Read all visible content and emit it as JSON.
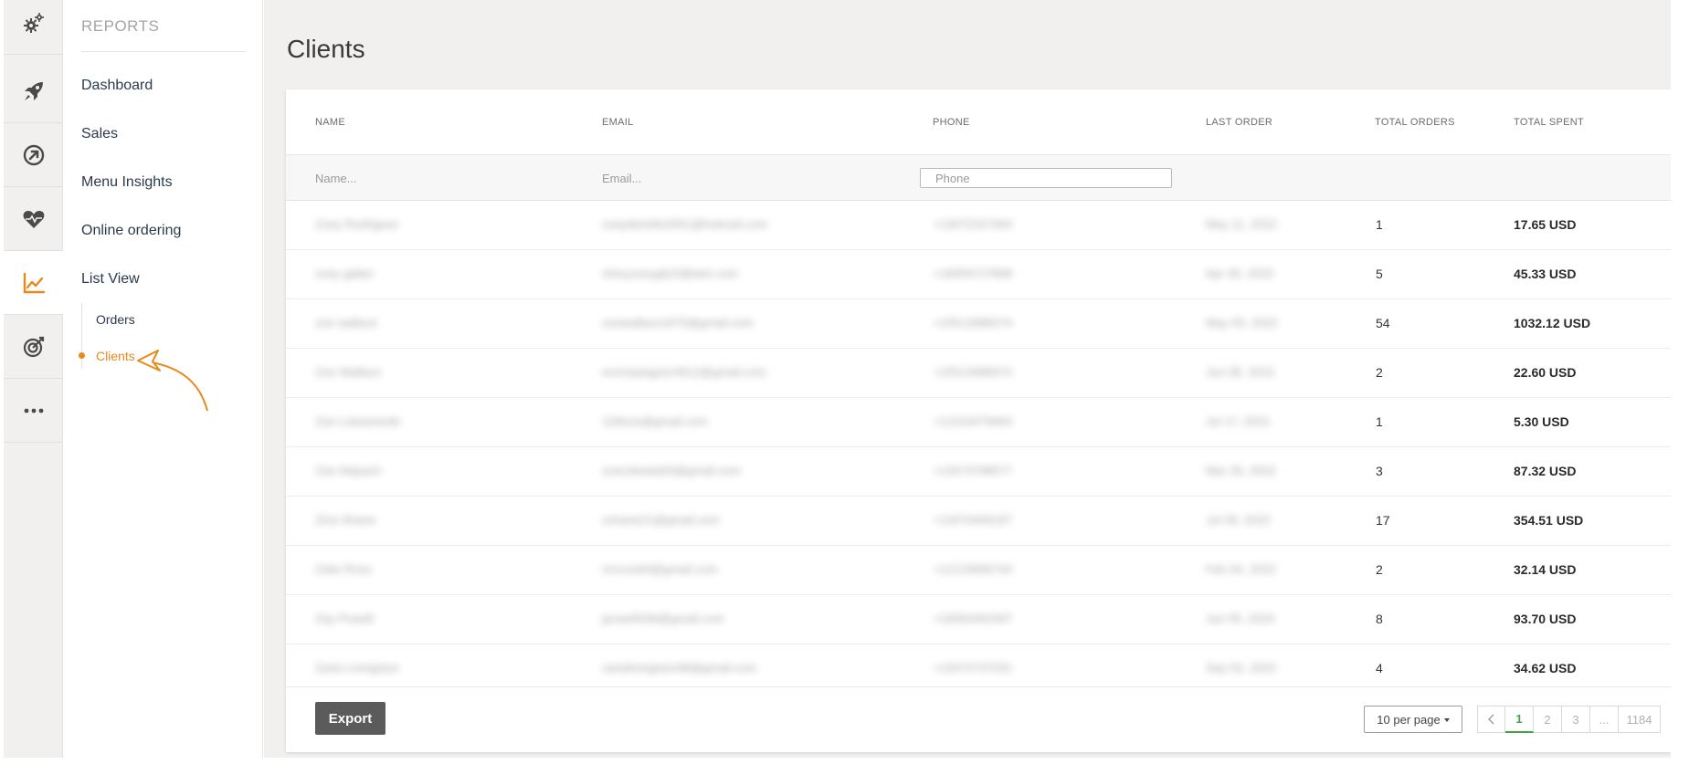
{
  "rail": {
    "items": [
      {
        "icon": "gears-icon"
      },
      {
        "icon": "rocket-icon"
      },
      {
        "icon": "compass-arrow-icon"
      },
      {
        "icon": "heart-pulse-icon"
      },
      {
        "icon": "line-chart-icon",
        "active": true
      },
      {
        "icon": "target-icon"
      },
      {
        "icon": "more-dots-icon"
      }
    ]
  },
  "subnav": {
    "section_title": "REPORTS",
    "links": [
      "Dashboard",
      "Sales",
      "Menu Insights",
      "Online ordering",
      "List View"
    ],
    "sublinks": [
      "Orders",
      "Clients"
    ],
    "active_sublink": "Clients",
    "accent_color": "#e8891c"
  },
  "page": {
    "title": "Clients"
  },
  "table": {
    "columns": [
      "NAME",
      "EMAIL",
      "PHONE",
      "LAST ORDER",
      "TOTAL ORDERS",
      "TOTAL SPENT"
    ],
    "filters": {
      "name_placeholder": "Name...",
      "email_placeholder": "Email...",
      "phone_placeholder": "Phone"
    },
    "rows": [
      {
        "name": "Zoey Rodriguez",
        "email": "zoeyderiello2001@hotmail.com",
        "phone": "+13472247464",
        "last_order": "May 11, 2022",
        "total_orders": "1",
        "total_spent": "17.65 USD"
      },
      {
        "name": "zoey gaber",
        "email": "shinyzoeygb23@aim.com",
        "phone": "+16059727808",
        "last_order": "Apr 30, 2022",
        "total_orders": "5",
        "total_spent": "45.33 USD"
      },
      {
        "name": "zoe wallace",
        "email": "zoewallace1975@gmail.com",
        "phone": "+15512688374",
        "last_order": "May 05, 2022",
        "total_orders": "54",
        "total_spent": "1032.12 USD"
      },
      {
        "name": "Zoe Wallace",
        "email": "emmawagner4612@gmail.com",
        "phone": "+15512688374",
        "last_order": "Jun 08, 2022",
        "total_orders": "2",
        "total_spent": "22.60 USD"
      },
      {
        "name": "Zoe Lukasewski",
        "email": "11lilzoe@gmail.com",
        "phone": "+12103479464",
        "last_order": "Jul 17, 2021",
        "total_orders": "1",
        "total_spent": "5.30 USD"
      },
      {
        "name": "Zoe Alapach",
        "email": "zoecelestia00@gmail.com",
        "phone": "+13473798077",
        "last_order": "Mar 26, 2022",
        "total_orders": "3",
        "total_spent": "87.32 USD"
      },
      {
        "name": "Zina Shane",
        "email": "zshane21@gmail.com",
        "phone": "+13476406187",
        "last_order": "Jul 09, 2022",
        "total_orders": "17",
        "total_spent": "354.51 USD"
      },
      {
        "name": "Zeke Ross",
        "email": "mrross64@gmail.com",
        "phone": "+12123606744",
        "last_order": "Feb 04, 2022",
        "total_orders": "2",
        "total_spent": "32.14 USD"
      },
      {
        "name": "Zay Powell",
        "email": "jpowell336@gmail.com",
        "phone": "+16093462497",
        "last_order": "Jun 05, 2020",
        "total_orders": "8",
        "total_spent": "93.70 USD"
      },
      {
        "name": "Zaria Livingston",
        "email": "zarialivingston98@gmail.com",
        "phone": "+13472747031",
        "last_order": "Sep 02, 2022",
        "total_orders": "4",
        "total_spent": "34.62 USD"
      }
    ]
  },
  "footer": {
    "export_label": "Export",
    "per_page_label": "10 per page",
    "pages": [
      "1",
      "2",
      "3",
      "...",
      "1184"
    ],
    "current_page": "1",
    "prev_icon": "chevron-left-icon"
  }
}
